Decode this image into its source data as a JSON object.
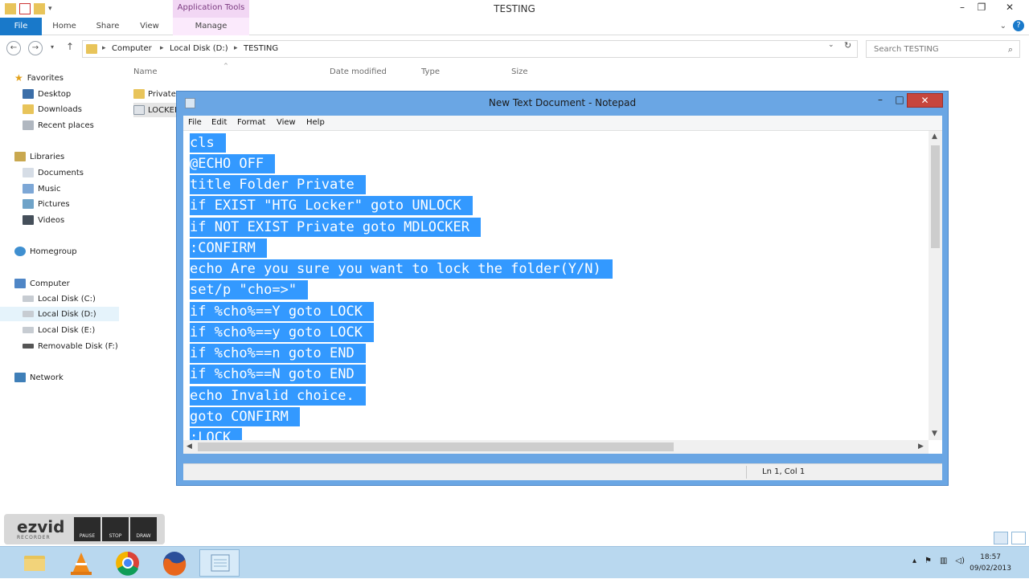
{
  "window": {
    "title": "TESTING",
    "app_tools_label": "Application Tools",
    "minimize": "–",
    "maximize": "❐",
    "close": "✕"
  },
  "ribbon": {
    "tabs": [
      "File",
      "Home",
      "Share",
      "View",
      "Manage"
    ],
    "expand_chevron": "⌄",
    "help": "?"
  },
  "address": {
    "crumbs": [
      "Computer",
      "Local Disk (D:)",
      "TESTING"
    ],
    "separator": "▸",
    "dropdown": "⌄",
    "refresh": "↻"
  },
  "search": {
    "placeholder": "Search TESTING",
    "icon": "search-icon"
  },
  "nav_pane": {
    "groups": [
      {
        "label": "Favorites",
        "items": [
          "Desktop",
          "Downloads",
          "Recent places"
        ]
      },
      {
        "label": "Libraries",
        "items": [
          "Documents",
          "Music",
          "Pictures",
          "Videos"
        ]
      },
      {
        "label": "Homegroup",
        "items": []
      },
      {
        "label": "Computer",
        "items": [
          "Local Disk (C:)",
          "Local Disk (D:)",
          "Local Disk (E:)",
          "Removable Disk (F:)"
        ]
      },
      {
        "label": "Network",
        "items": []
      }
    ],
    "selected": "Local Disk (D:)"
  },
  "file_list": {
    "columns": [
      "Name",
      "Date modified",
      "Type",
      "Size"
    ],
    "rows": [
      "Private",
      "LOCKER"
    ]
  },
  "notepad": {
    "title": "New Text Document - Notepad",
    "menu": [
      "File",
      "Edit",
      "Format",
      "View",
      "Help"
    ],
    "lines": [
      "cls",
      "@ECHO OFF",
      "title Folder Private",
      "if EXIST \"HTG Locker\" goto UNLOCK",
      "if NOT EXIST Private goto MDLOCKER",
      ":CONFIRM",
      "echo Are you sure you want to lock the folder(Y/N)",
      "set/p \"cho=>\"",
      "if %cho%==Y goto LOCK",
      "if %cho%==y goto LOCK",
      "if %cho%==n goto END",
      "if %cho%==N goto END",
      "echo Invalid choice.",
      "goto CONFIRM",
      ":LOCK"
    ],
    "status": "Ln 1, Col 1",
    "selection_color": "#3399ff"
  },
  "recorder": {
    "logo": "ezvid",
    "subtitle": "RECORDER",
    "buttons": [
      "PAUSE",
      "STOP",
      "DRAW"
    ]
  },
  "taskbar": {
    "apps": [
      "file-explorer",
      "vlc",
      "chrome",
      "firefox",
      "notepad"
    ],
    "time": "18:57",
    "date": "09/02/2013",
    "tray_up": "▴"
  }
}
